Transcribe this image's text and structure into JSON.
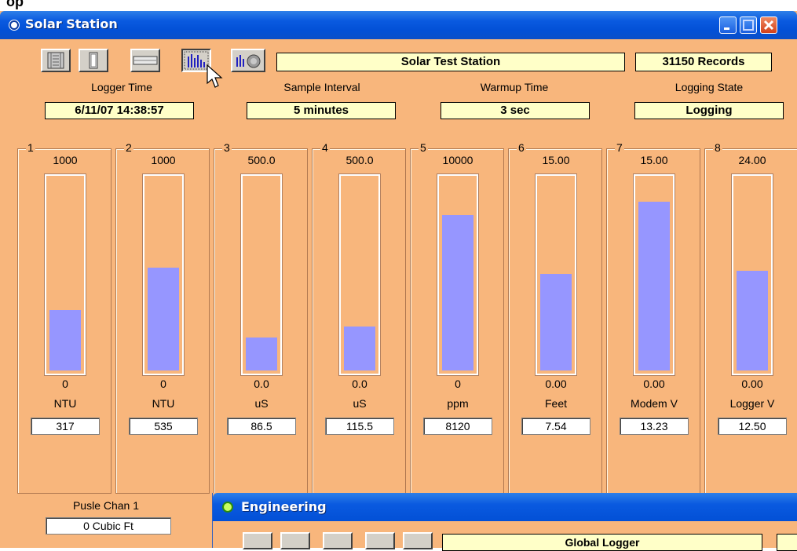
{
  "top_strip": {
    "text": "op"
  },
  "window": {
    "title": "Solar Station",
    "toolbar": [
      "panel-view-icon",
      "single-column-icon",
      "horizontal-bar-icon",
      "bar-chart-icon",
      "bar-chart-gauge-icon"
    ],
    "station_name": "Solar Test Station",
    "records": "31150 Records"
  },
  "status": {
    "logger_time_label": "Logger Time",
    "logger_time_value": "6/11/07 14:38:57",
    "sample_interval_label": "Sample Interval",
    "sample_interval_value": "5 minutes",
    "warmup_time_label": "Warmup Time",
    "warmup_time_value": "3 sec",
    "logging_state_label": "Logging State",
    "logging_state_value": "Logging"
  },
  "channels": [
    {
      "num": "1",
      "max": "1000",
      "min": "0",
      "unit": "NTU",
      "value": "317",
      "level": 0.317
    },
    {
      "num": "2",
      "max": "1000",
      "min": "0",
      "unit": "NTU",
      "value": "535",
      "level": 0.535
    },
    {
      "num": "3",
      "max": "500.0",
      "min": "0.0",
      "unit": "uS",
      "value": "86.5",
      "level": 0.173
    },
    {
      "num": "4",
      "max": "500.0",
      "min": "0.0",
      "unit": "uS",
      "value": "115.5",
      "level": 0.231
    },
    {
      "num": "5",
      "max": "10000",
      "min": "0",
      "unit": "ppm",
      "value": "8120",
      "level": 0.812
    },
    {
      "num": "6",
      "max": "15.00",
      "min": "0.00",
      "unit": "Feet",
      "value": "7.54",
      "level": 0.503
    },
    {
      "num": "7",
      "max": "15.00",
      "min": "0.00",
      "unit": "Modem V",
      "value": "13.23",
      "level": 0.882
    },
    {
      "num": "8",
      "max": "24.00",
      "min": "0.00",
      "unit": "Logger V",
      "value": "12.50",
      "level": 0.521
    }
  ],
  "pulse": {
    "label": "Pusle Chan 1",
    "value": "0 Cubic Ft"
  },
  "engineering": {
    "title": "Engineering",
    "station_name": "Global Logger"
  },
  "colors": {
    "fill": "#9696ff",
    "panel": "#f8b67c",
    "field": "#ffffc8",
    "titlebar": "#0a5ae0"
  }
}
